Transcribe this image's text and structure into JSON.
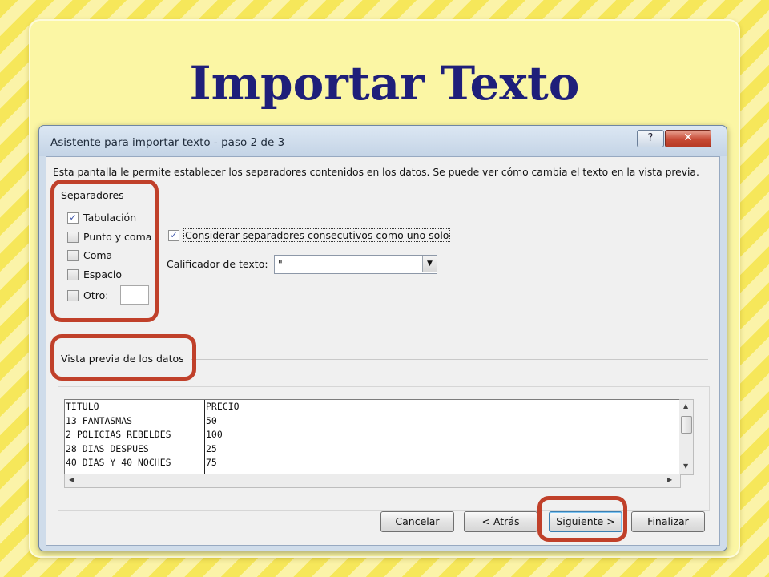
{
  "slide": {
    "title": "Importar Texto"
  },
  "dialog": {
    "title": "Asistente para importar texto - paso 2 de 3",
    "help_label": "?",
    "close_label": "✕",
    "description": "Esta pantalla le permite establecer los separadores contenidos en los datos. Se puede ver cómo cambia el texto en la vista previa.",
    "separators": {
      "group_label": "Separadores",
      "items": [
        {
          "label": "Tabulación",
          "checked": true
        },
        {
          "label": "Punto y coma",
          "checked": false
        },
        {
          "label": "Coma",
          "checked": false
        },
        {
          "label": "Espacio",
          "checked": false
        },
        {
          "label": "Otro:",
          "checked": false
        }
      ],
      "other_value": ""
    },
    "consecutive": {
      "label": "Considerar separadores consecutivos como uno solo",
      "checked": true
    },
    "qualifier": {
      "label": "Calificador de texto:",
      "value": "\""
    },
    "preview": {
      "group_label": "Vista previa de los datos",
      "col1": [
        "TITULO",
        "13 FANTASMAS",
        "2 POLICIAS REBELDES",
        "28 DIAS DESPUES",
        "40 DIAS Y 40 NOCHES"
      ],
      "col2": [
        "PRECIO",
        "50",
        "100",
        "25",
        "75"
      ]
    },
    "buttons": {
      "cancel": "Cancelar",
      "back": "< Atrás",
      "next": "Siguiente >",
      "finish": "Finalizar"
    }
  },
  "colors": {
    "highlight": "#c0402a",
    "title": "#1f1f7a",
    "check": "#3a52a8"
  },
  "icons": {
    "check": "✓",
    "dropdown": "▼",
    "up": "▲",
    "down": "▼",
    "left": "◀",
    "right": "▶"
  }
}
